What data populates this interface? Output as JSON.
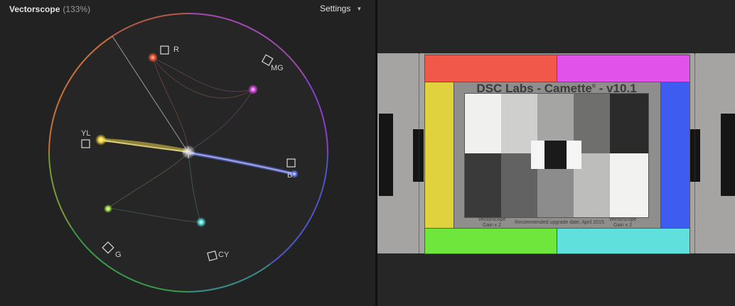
{
  "scope": {
    "title": "Vectorscope",
    "zoom": "(133%)",
    "settings_label": "Settings",
    "targets": {
      "r": "R",
      "mg": "MG",
      "b": "B",
      "cy": "CY",
      "g": "G",
      "yl": "YL"
    }
  },
  "viewer": {
    "chart_title": "DSC Labs - Camette",
    "chart_title_mark": "®",
    "chart_version": " - v10.1",
    "label_left": "Vectorscope\nGain x 2",
    "label_center": "Recommended upgrade date, April 2015",
    "label_right": "Vectorscope\nGain x 2",
    "colors": {
      "red": "#f2584a",
      "magenta": "#e052ea",
      "yellow": "#dfd23e",
      "blue": "#3f5cf0",
      "green": "#6ee63c",
      "cyan": "#5fe0dc"
    }
  }
}
